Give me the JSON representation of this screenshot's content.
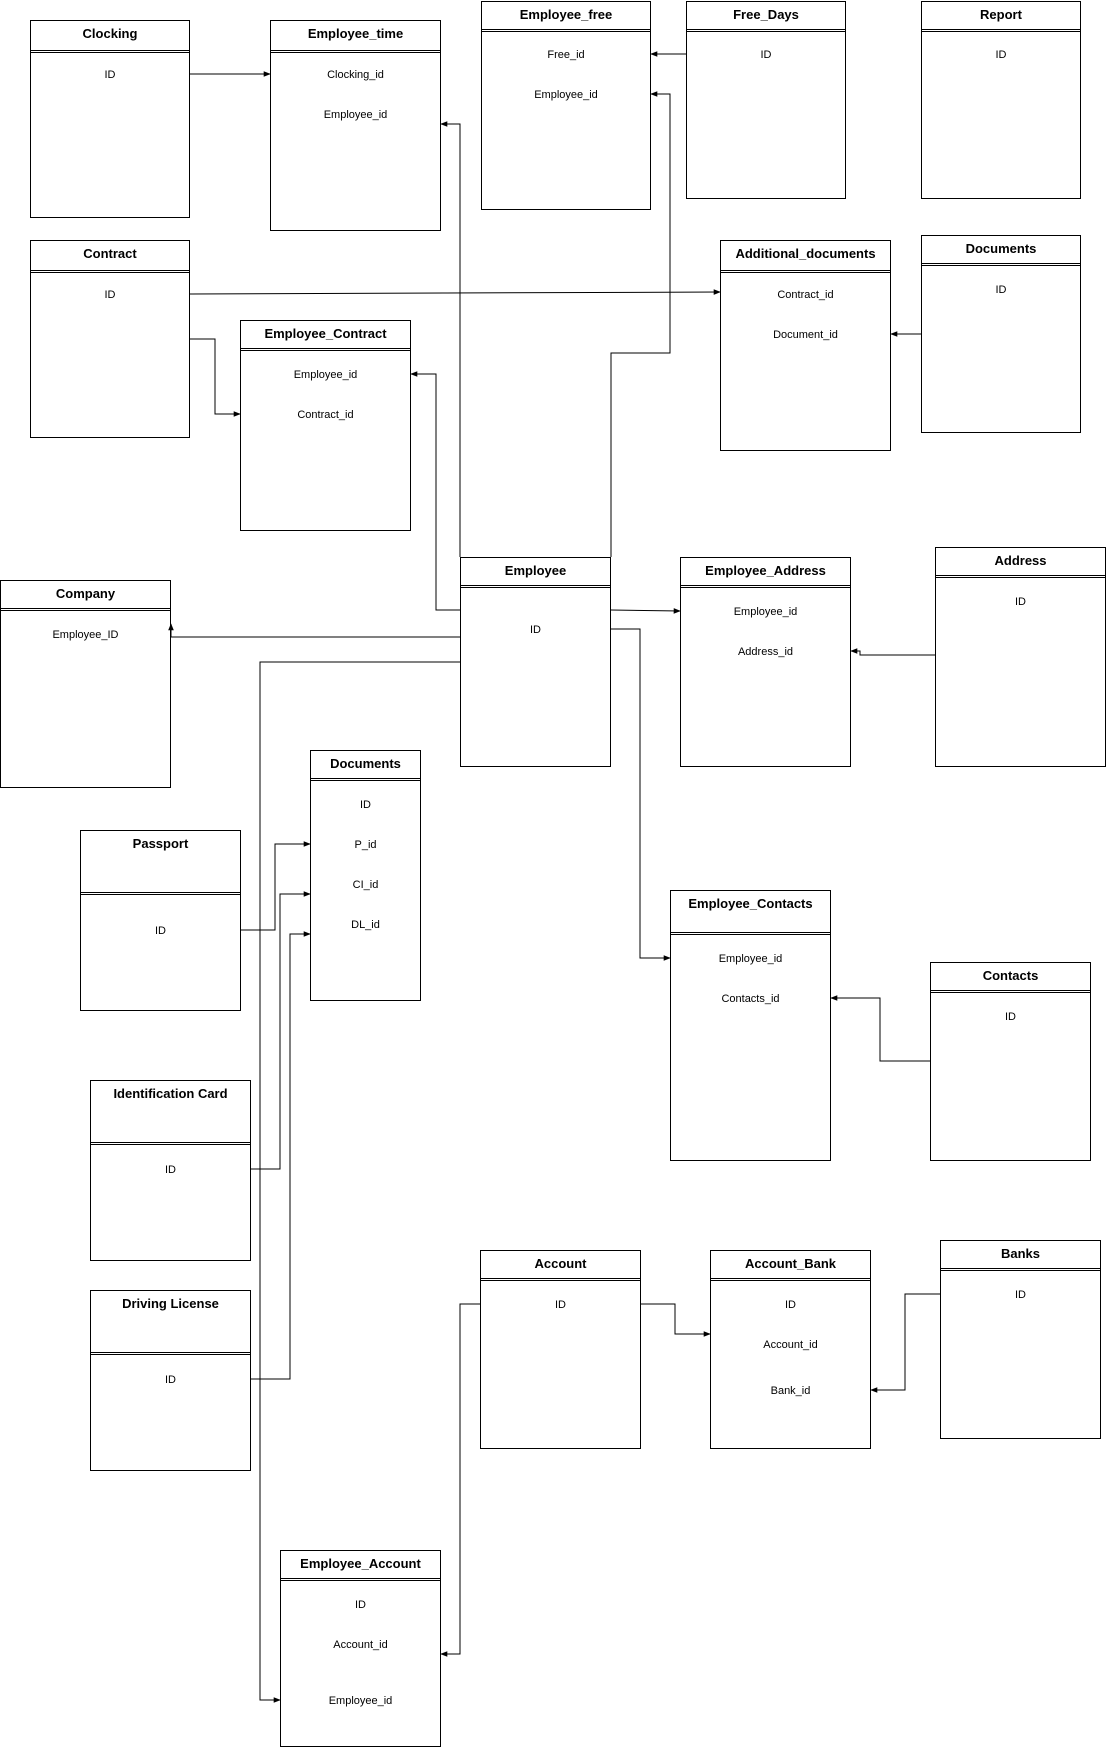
{
  "entities": {
    "clocking": {
      "title": "Clocking",
      "fields": [
        "ID"
      ]
    },
    "employee_time": {
      "title": "Employee_time",
      "fields": [
        "Clocking_id",
        "Employee_id"
      ]
    },
    "employee_free": {
      "title": "Employee_free",
      "fields": [
        "Free_id",
        "Employee_id"
      ]
    },
    "free_days": {
      "title": "Free_Days",
      "fields": [
        "ID"
      ]
    },
    "report": {
      "title": "Report",
      "fields": [
        "ID"
      ]
    },
    "contract": {
      "title": "Contract",
      "fields": [
        "ID"
      ]
    },
    "additional_documents": {
      "title": "Additional_documents",
      "fields": [
        "Contract_id",
        "Document_id"
      ]
    },
    "documents_top": {
      "title": "Documents",
      "fields": [
        "ID"
      ]
    },
    "employee_contract": {
      "title": "Employee_Contract",
      "fields": [
        "Employee_id",
        "Contract_id"
      ]
    },
    "employee": {
      "title": "Employee",
      "fields": [
        "ID"
      ]
    },
    "employee_address": {
      "title": "Employee_Address",
      "fields": [
        "Employee_id",
        "Address_id"
      ]
    },
    "address": {
      "title": "Address",
      "fields": [
        "ID"
      ]
    },
    "company": {
      "title": "Company",
      "fields": [
        "Employee_ID"
      ]
    },
    "documents_mid": {
      "title": "Documents",
      "fields": [
        "ID",
        "P_id",
        "CI_id",
        "DL_id"
      ]
    },
    "passport": {
      "title": "Passport",
      "fields": [
        "ID"
      ]
    },
    "employee_contacts": {
      "title": "Employee_Contacts",
      "fields": [
        "Employee_id",
        "Contacts_id"
      ]
    },
    "contacts": {
      "title": "Contacts",
      "fields": [
        "ID"
      ]
    },
    "identification_card": {
      "title": "Identification Card",
      "fields": [
        "ID"
      ]
    },
    "driving_license": {
      "title": "Driving License",
      "fields": [
        "ID"
      ]
    },
    "account": {
      "title": "Account",
      "fields": [
        "ID"
      ]
    },
    "account_bank": {
      "title": "Account_Bank",
      "fields": [
        "ID",
        "Account_id",
        "Bank_id"
      ]
    },
    "banks": {
      "title": "Banks",
      "fields": [
        "ID"
      ]
    },
    "employee_account": {
      "title": "Employee_Account",
      "fields": [
        "ID",
        "Account_id",
        "Employee_id"
      ]
    }
  }
}
